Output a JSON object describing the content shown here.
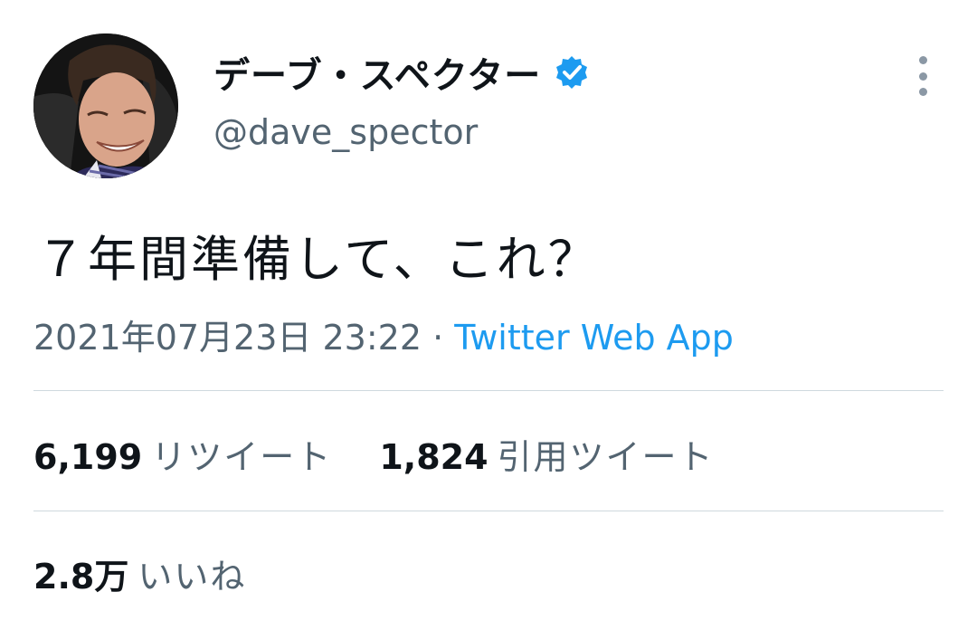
{
  "author": {
    "display_name": "デーブ・スペクター",
    "handle": "@dave_spector",
    "verified_icon": "verified-badge-icon"
  },
  "tweet": {
    "text": "７年間準備して、これ？",
    "timestamp": "2021年07月23日 23:22",
    "separator": "·",
    "source": "Twitter Web App"
  },
  "stats": {
    "retweets": {
      "count": "6,199",
      "label": "リツイート"
    },
    "quotes": {
      "count": "1,824",
      "label": "引用ツイート"
    },
    "likes": {
      "count": "2.8万",
      "label": "いいね"
    }
  },
  "colors": {
    "text_primary": "#0f1419",
    "text_secondary": "#536471",
    "link": "#1d9bf0",
    "divider": "#cfd9de",
    "verified": "#1d9bf0"
  }
}
